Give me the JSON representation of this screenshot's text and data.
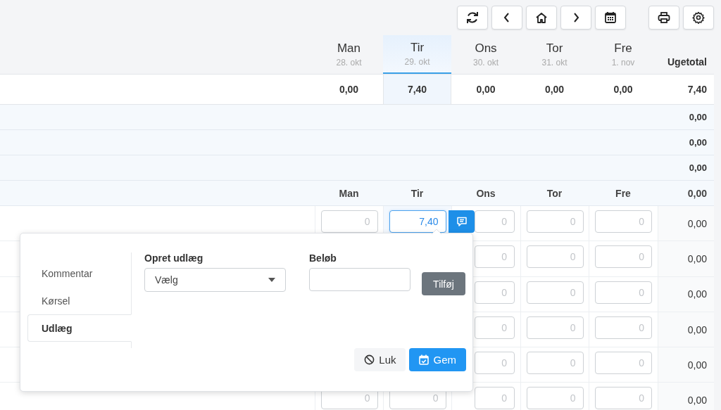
{
  "days": [
    {
      "day": "Man",
      "date": "28. okt",
      "selected": false
    },
    {
      "day": "Tir",
      "date": "29. okt",
      "selected": true
    },
    {
      "day": "Ons",
      "date": "30. okt",
      "selected": false
    },
    {
      "day": "Tor",
      "date": "31. okt",
      "selected": false
    },
    {
      "day": "Fre",
      "date": "1. nov",
      "selected": false
    }
  ],
  "week_total_label": "Ugetotal",
  "totals_row": {
    "values": [
      "0,00",
      "7,40",
      "0,00",
      "0,00",
      "0,00"
    ],
    "total": "7,40"
  },
  "summary_rows": [
    {
      "total": "0,00"
    },
    {
      "total": "0,00"
    },
    {
      "total": "0,00"
    }
  ],
  "entry_header": {
    "days": [
      "Man",
      "Tir",
      "Ons",
      "Tor",
      "Fre"
    ],
    "total": "0,00"
  },
  "entry_rows": [
    {
      "cells": [
        {
          "placeholder": "0",
          "focused": false
        },
        {
          "value": "7,40",
          "focused": true
        },
        {
          "placeholder": "0",
          "focused": false
        },
        {
          "placeholder": "0",
          "focused": false
        },
        {
          "placeholder": "0",
          "focused": false
        }
      ],
      "total": "0,00"
    },
    {
      "cells": [
        null,
        null,
        {
          "placeholder": "0",
          "focused": false
        },
        {
          "placeholder": "0",
          "focused": false
        },
        {
          "placeholder": "0",
          "focused": false
        }
      ],
      "total": "0,00"
    },
    {
      "cells": [
        null,
        null,
        {
          "placeholder": "0",
          "focused": false
        },
        {
          "placeholder": "0",
          "focused": false
        },
        {
          "placeholder": "0",
          "focused": false
        }
      ],
      "total": "0,00"
    },
    {
      "cells": [
        null,
        null,
        {
          "placeholder": "0",
          "focused": false
        },
        {
          "placeholder": "0",
          "focused": false
        },
        {
          "placeholder": "0",
          "focused": false
        }
      ],
      "total": "0,00"
    },
    {
      "cells": [
        null,
        null,
        {
          "placeholder": "0",
          "focused": false
        },
        {
          "placeholder": "0",
          "focused": false
        },
        {
          "placeholder": "0",
          "focused": false
        }
      ],
      "total": "0,00"
    },
    {
      "cells": [
        {
          "placeholder": "0",
          "focused": false
        },
        {
          "placeholder": "0",
          "focused": false
        },
        {
          "placeholder": "0",
          "focused": false
        },
        {
          "placeholder": "0",
          "focused": false
        },
        {
          "placeholder": "0",
          "focused": false
        }
      ],
      "total": "0,00"
    }
  ],
  "popup": {
    "tabs": [
      {
        "label": "Kommentar",
        "selected": false
      },
      {
        "label": "Kørsel",
        "selected": false
      },
      {
        "label": "Udlæg",
        "selected": true
      }
    ],
    "select_label": "Opret udlæg",
    "select_value": "Vælg",
    "amount_label": "Beløb",
    "add_button": "Tilføj",
    "buttons": [
      {
        "label": "Luk",
        "kind": "close"
      },
      {
        "label": "Gem",
        "kind": "save"
      }
    ]
  }
}
